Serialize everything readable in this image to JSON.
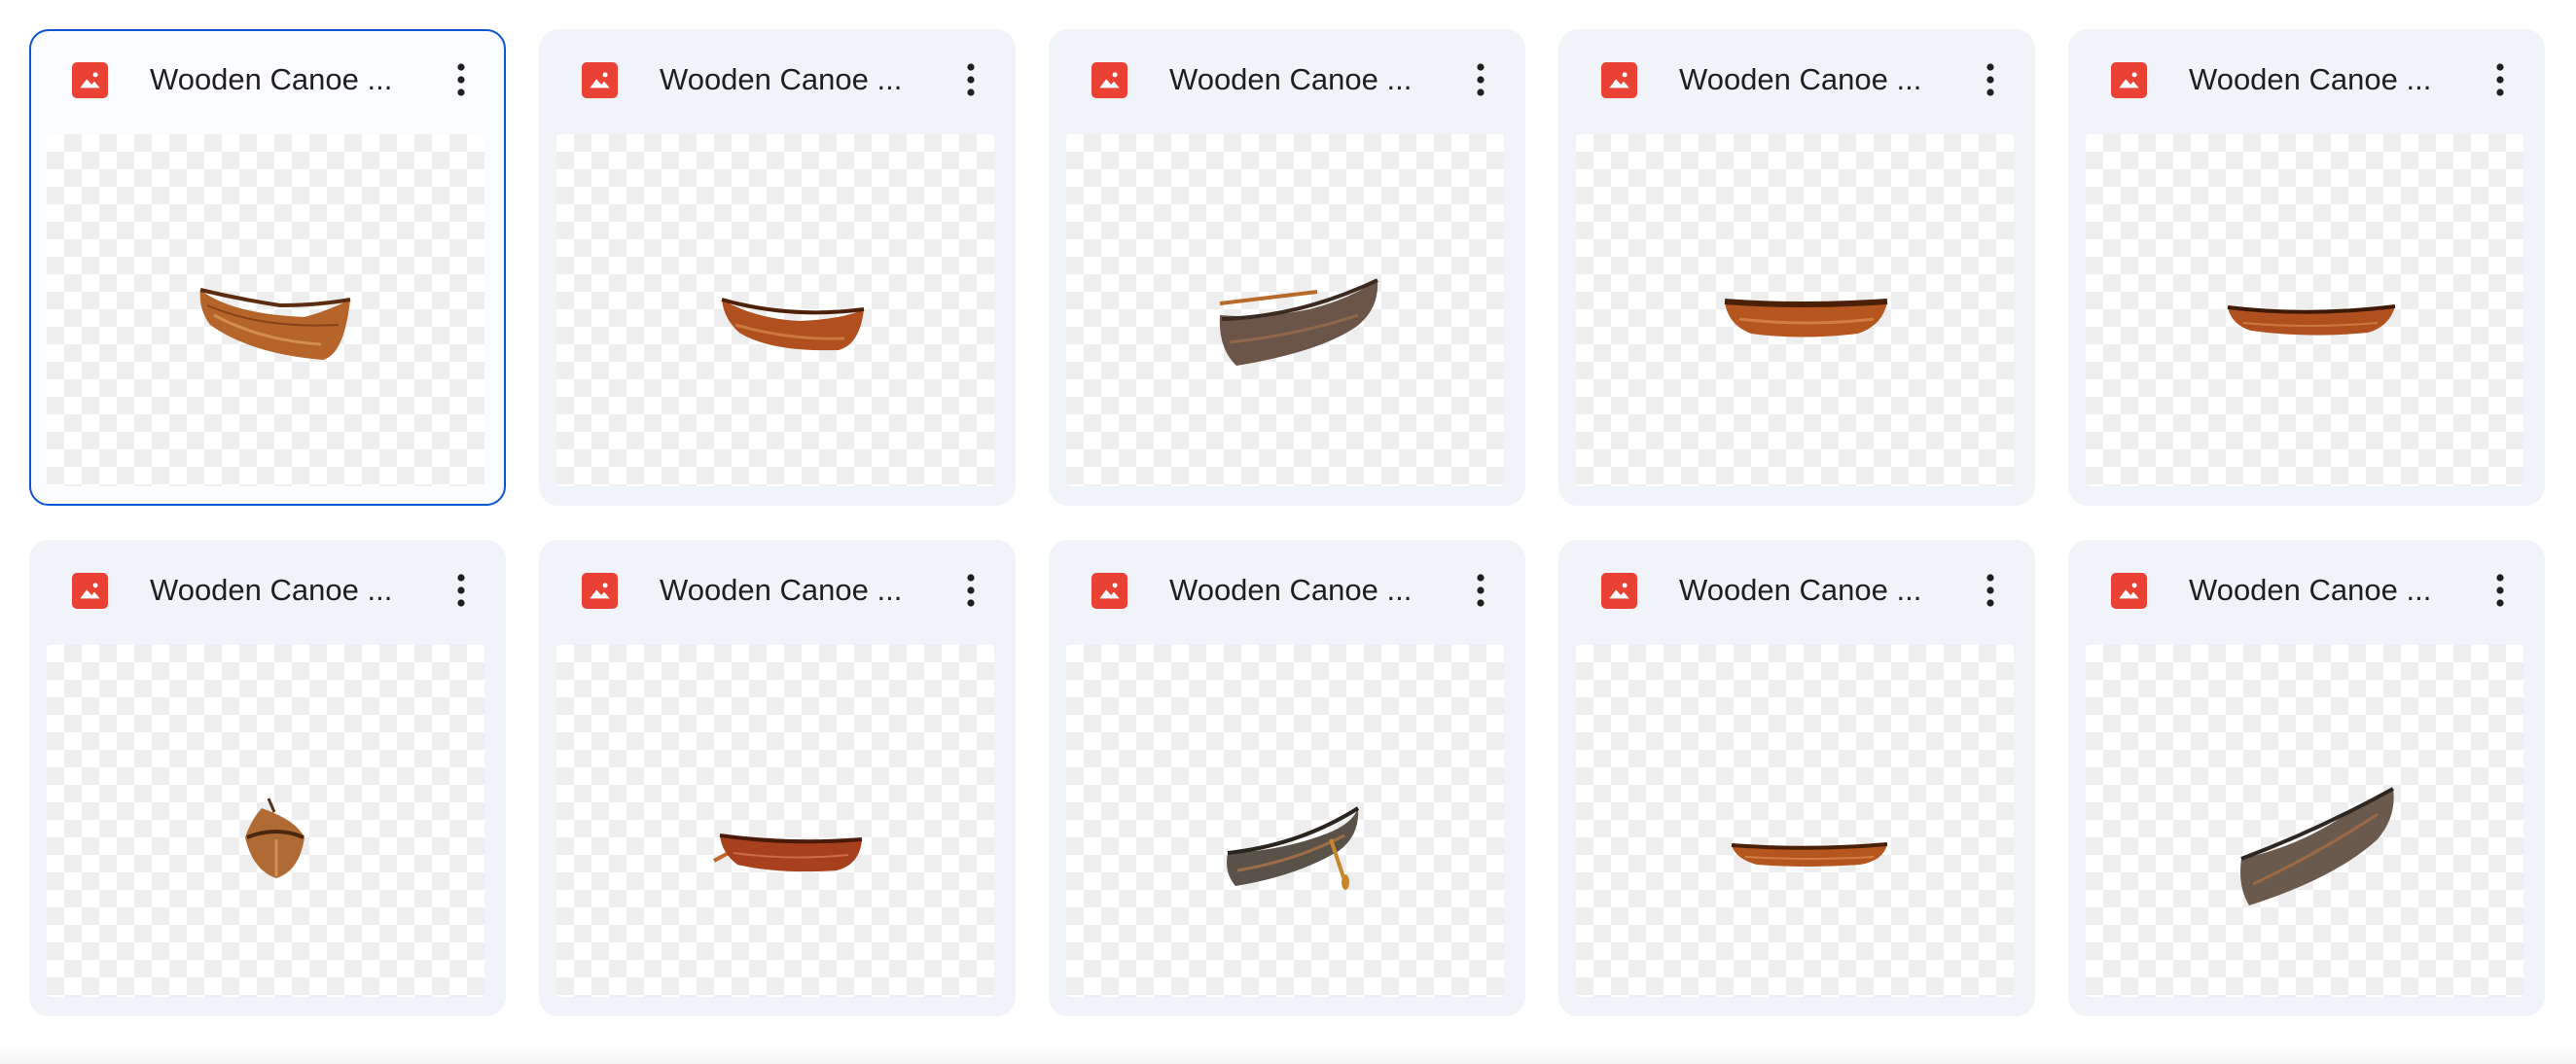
{
  "file_type_icon": "image-file-icon",
  "more_icon": "more-vertical-icon",
  "colors": {
    "accent": "#0b57d0",
    "card_bg": "#f0f4f9",
    "image_icon": "#e94235",
    "title_text": "#1f1f1f"
  },
  "files": [
    {
      "name": "Wooden Canoe ...",
      "selected": true,
      "thumbnail": "wooden canoe, three-quarter view"
    },
    {
      "name": "Wooden Canoe ...",
      "selected": false,
      "thumbnail": "wooden canoe, three-quarter view"
    },
    {
      "name": "Wooden Canoe ...",
      "selected": false,
      "thumbnail": "weathered wooden canoe with paddle"
    },
    {
      "name": "Wooden Canoe ...",
      "selected": false,
      "thumbnail": "wooden canoe, side view"
    },
    {
      "name": "Wooden Canoe ...",
      "selected": false,
      "thumbnail": "wooden canoe, side view"
    },
    {
      "name": "Wooden Canoe ...",
      "selected": false,
      "thumbnail": "wooden canoe, front view"
    },
    {
      "name": "Wooden Canoe ...",
      "selected": false,
      "thumbnail": "wooden canoe with paddle"
    },
    {
      "name": "Wooden Canoe ...",
      "selected": false,
      "thumbnail": "weathered canoe with paddle"
    },
    {
      "name": "Wooden Canoe ...",
      "selected": false,
      "thumbnail": "wooden canoe, side view"
    },
    {
      "name": "Wooden Canoe ...",
      "selected": false,
      "thumbnail": "weathered wooden canoe, angled"
    }
  ]
}
